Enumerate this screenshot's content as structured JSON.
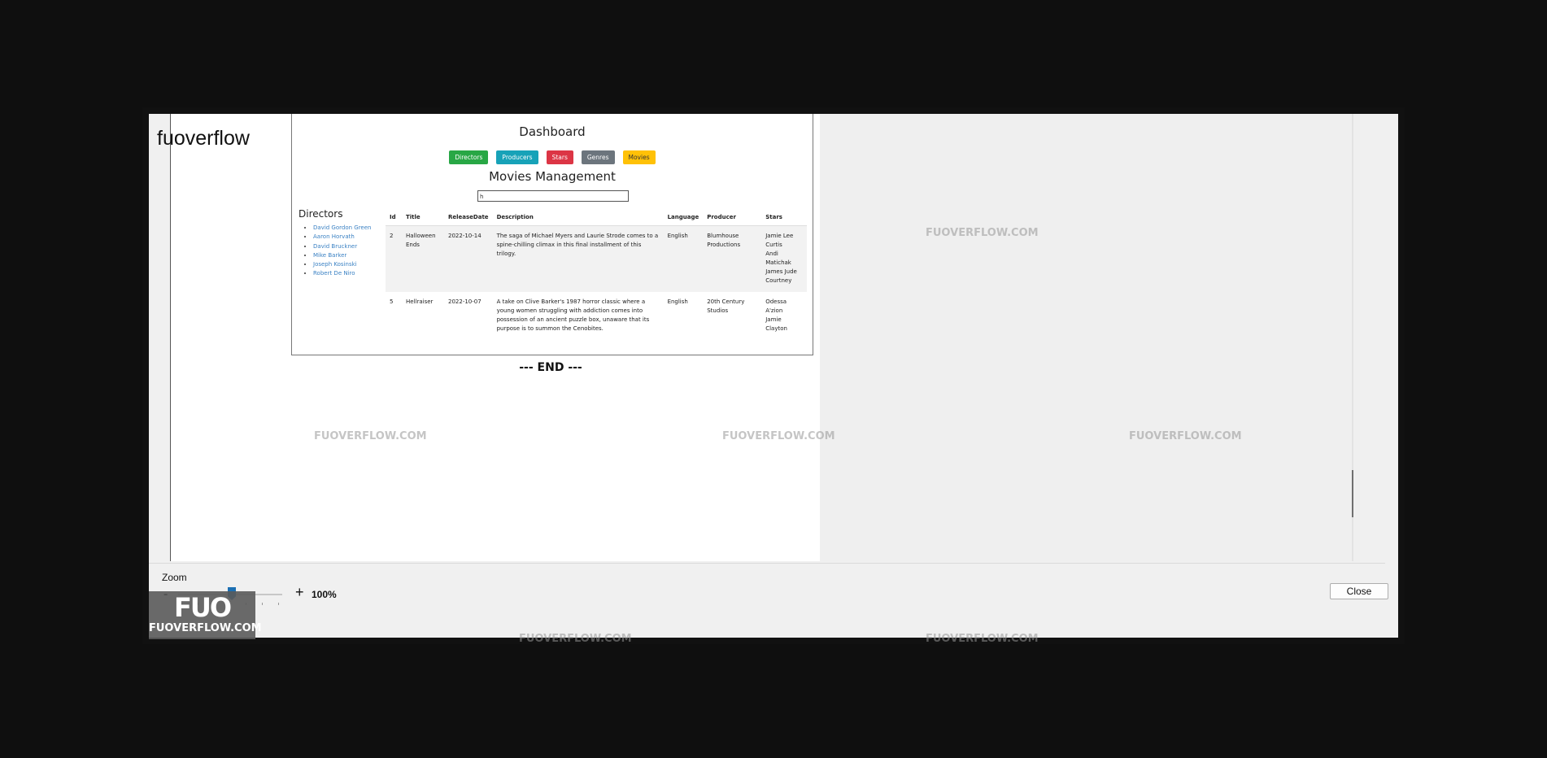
{
  "window": {
    "brand": "fuoverflow"
  },
  "screenshot": {
    "dashboard_title": "Dashboard",
    "nav_buttons": [
      {
        "label": "Directors",
        "color": "#28a745"
      },
      {
        "label": "Producers",
        "color": "#17a2b8"
      },
      {
        "label": "Stars",
        "color": "#dc3545"
      },
      {
        "label": "Genres",
        "color": "#6c757d"
      },
      {
        "label": "Movies",
        "color": "#ffc107"
      }
    ],
    "management_title": "Movies Management",
    "search_value": "h",
    "directors_heading": "Directors",
    "directors": [
      "David Gordon Green",
      "Aaron Horvath",
      "David Bruckner",
      "Mike Barker",
      "Joseph Kosinski",
      "Robert De Niro"
    ],
    "table": {
      "headers": [
        "Id",
        "Title",
        "ReleaseDate",
        "Description",
        "Language",
        "Producer",
        "Stars"
      ],
      "rows": [
        {
          "id": "2",
          "title": "Halloween Ends",
          "release_date": "2022-10-14",
          "description": "The saga of Michael Myers and Laurie Strode comes to a spine-chilling climax in this final installment of this trilogy.",
          "language": "English",
          "producer": "Blumhouse Productions",
          "stars": [
            "Jamie Lee Curtis",
            "Andi Matichak",
            "James Jude",
            "Courtney"
          ]
        },
        {
          "id": "5",
          "title": "Hellraiser",
          "release_date": "2022-10-07",
          "description": "A take on Clive Barker's 1987 horror classic where a young women struggling with addiction comes into possession of an ancient puzzle box, unaware that its purpose is to summon the Cenobites.",
          "language": "English",
          "producer": "20th Century Studios",
          "stars": [
            "Odessa A'zion",
            "Jamie Clayton"
          ]
        }
      ]
    }
  },
  "end_marker": "--- END ---",
  "zoom": {
    "label": "Zoom",
    "minus": "-",
    "plus": "+",
    "value": "100%",
    "level_fraction": 0.5
  },
  "close_label": "Close",
  "watermark": {
    "mark": "FUO",
    "site": "FUOVERFLOW.COM"
  }
}
